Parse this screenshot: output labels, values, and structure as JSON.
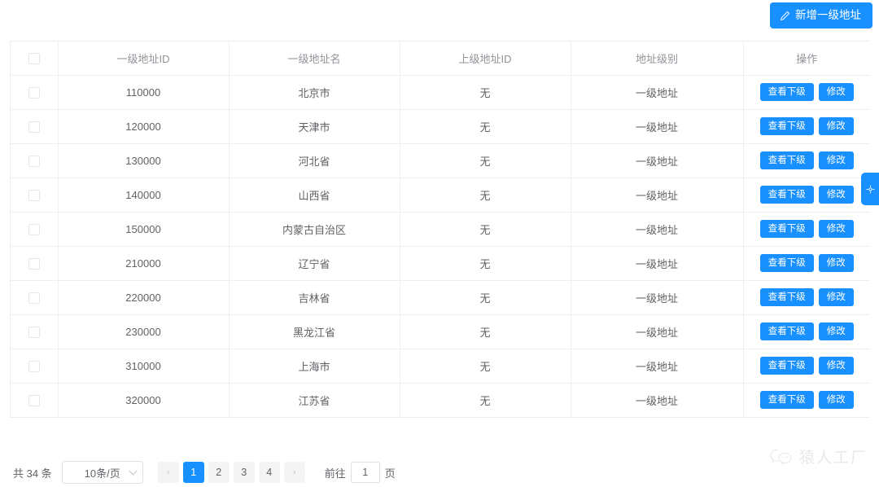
{
  "toolbar": {
    "add_button_label": "新增一级地址",
    "add_button_icon": "pen-icon",
    "accent_color": "#1890ff"
  },
  "side_tab": {
    "icon": "gear-icon",
    "color": "#1890ff"
  },
  "table": {
    "columns": [
      {
        "key": "check",
        "label": ""
      },
      {
        "key": "id",
        "label": "一级地址ID"
      },
      {
        "key": "name",
        "label": "一级地址名"
      },
      {
        "key": "parent_id",
        "label": "上级地址ID"
      },
      {
        "key": "level",
        "label": "地址级别"
      },
      {
        "key": "actions",
        "label": "操作"
      }
    ],
    "action_labels": {
      "view_children": "查看下级",
      "edit": "修改"
    },
    "rows": [
      {
        "id": "110000",
        "name": "北京市",
        "parent_id": "无",
        "level": "一级地址",
        "checked": false
      },
      {
        "id": "120000",
        "name": "天津市",
        "parent_id": "无",
        "level": "一级地址",
        "checked": false
      },
      {
        "id": "130000",
        "name": "河北省",
        "parent_id": "无",
        "level": "一级地址",
        "checked": false
      },
      {
        "id": "140000",
        "name": "山西省",
        "parent_id": "无",
        "level": "一级地址",
        "checked": false
      },
      {
        "id": "150000",
        "name": "内蒙古自治区",
        "parent_id": "无",
        "level": "一级地址",
        "checked": false
      },
      {
        "id": "210000",
        "name": "辽宁省",
        "parent_id": "无",
        "level": "一级地址",
        "checked": false
      },
      {
        "id": "220000",
        "name": "吉林省",
        "parent_id": "无",
        "level": "一级地址",
        "checked": false
      },
      {
        "id": "230000",
        "name": "黑龙江省",
        "parent_id": "无",
        "level": "一级地址",
        "checked": false
      },
      {
        "id": "310000",
        "name": "上海市",
        "parent_id": "无",
        "level": "一级地址",
        "checked": false
      },
      {
        "id": "320000",
        "name": "江苏省",
        "parent_id": "无",
        "level": "一级地址",
        "checked": false
      }
    ]
  },
  "pagination": {
    "total_label": "共 34 条",
    "page_size_value": "10条/页",
    "prev_glyph": "‹",
    "next_glyph": "›",
    "pages": [
      "1",
      "2",
      "3",
      "4"
    ],
    "current_page": "1",
    "jump_prefix": "前往",
    "jump_value": "1",
    "jump_suffix": "页"
  },
  "watermark": {
    "text": "猿人工厂",
    "icon": "wechat-icon"
  }
}
